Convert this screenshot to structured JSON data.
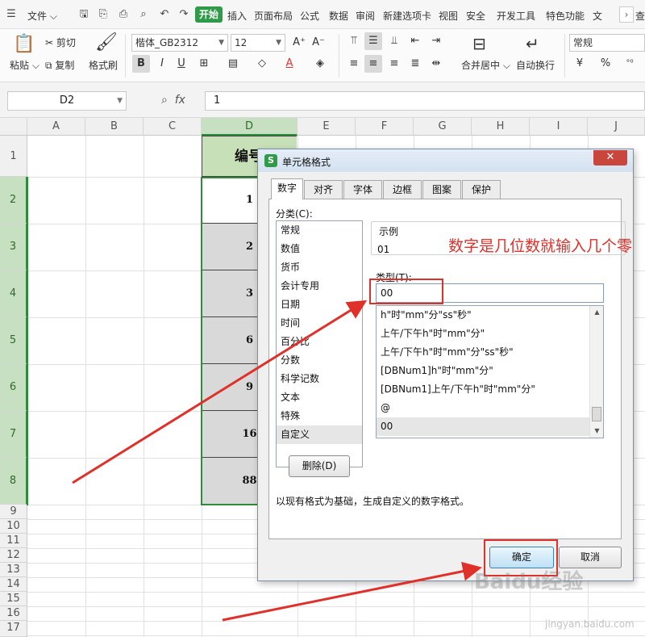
{
  "menubar": {
    "file_label": "文件",
    "active_tab": "开始",
    "tabs": [
      "插入",
      "页面布局",
      "公式",
      "数据",
      "审阅",
      "新建选项卡",
      "视图",
      "安全",
      "开发工具",
      "特色功能",
      "文"
    ],
    "search_stub": "查"
  },
  "ribbon": {
    "paste_label": "粘贴",
    "cut_label": "剪切",
    "copy_label": "复制",
    "format_painter_label": "格式刷",
    "font_name": "楷体_GB2312",
    "font_size": "12",
    "merge_label": "合并居中",
    "wrap_label": "自动换行",
    "number_format": "常规",
    "bold_label": "B",
    "italic_label": "I",
    "underline_label": "U",
    "percent_label": "%"
  },
  "formula_bar": {
    "name_box": "D2",
    "fx_label": "fx",
    "value": "1"
  },
  "sheet": {
    "columns": [
      "A",
      "B",
      "C",
      "D",
      "E",
      "F",
      "G",
      "H",
      "I",
      "J"
    ],
    "rows": [
      "1",
      "2",
      "3",
      "4",
      "5",
      "6",
      "7",
      "8",
      "9",
      "10",
      "11",
      "12",
      "13",
      "14",
      "15",
      "16",
      "17"
    ],
    "header_cell": "编号",
    "d_values": [
      "1",
      "2",
      "3",
      "6",
      "9",
      "16",
      "88"
    ]
  },
  "dialog": {
    "logo": "S",
    "title": "单元格格式",
    "close": "✕",
    "tabs": [
      "数字",
      "对齐",
      "字体",
      "边框",
      "图案",
      "保护"
    ],
    "category_label": "分类(C):",
    "categories": [
      "常规",
      "数值",
      "货币",
      "会计专用",
      "日期",
      "时间",
      "百分比",
      "分数",
      "科学记数",
      "文本",
      "特殊",
      "自定义"
    ],
    "sample_label": "示例",
    "sample_value": "01",
    "type_label": "类型(T):",
    "type_value": "00",
    "formats": [
      "h\"时\"mm\"分\"ss\"秒\"",
      "上午/下午h\"时\"mm\"分\"",
      "上午/下午h\"时\"mm\"分\"ss\"秒\"",
      "[DBNum1]h\"时\"mm\"分\"",
      "[DBNum1]上午/下午h\"时\"mm\"分\"",
      "@",
      "00"
    ],
    "delete_button": "删除(D)",
    "description": "以现有格式为基础，生成自定义的数字格式。",
    "ok_button": "确定",
    "cancel_button": "取消"
  },
  "annotation": {
    "text": "数字是几位数就输入几个零",
    "color": "#e0302a"
  },
  "watermark": {
    "text": "Baidu经验",
    "sub": "jingyan.baidu.com"
  },
  "colors": {
    "accent_green": "#2f9b49",
    "selection_green": "#2e8b3a",
    "annotation_red": "#e0302a"
  }
}
